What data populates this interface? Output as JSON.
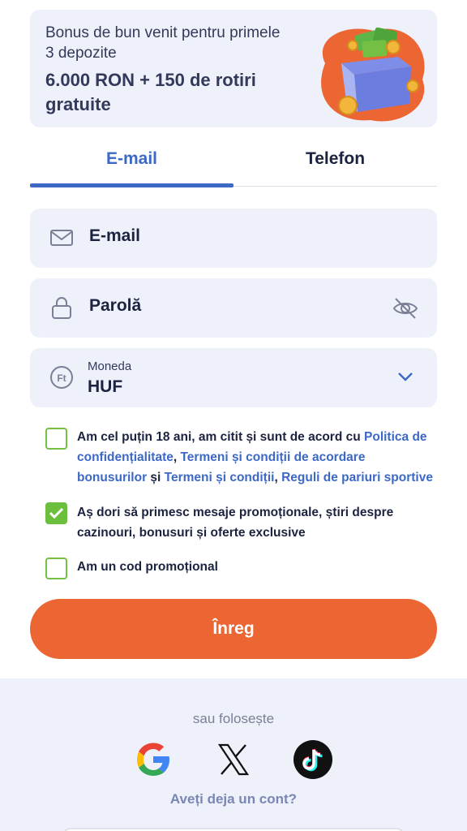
{
  "promo": {
    "subtitle": "Bonus de bun venit pentru primele 3 depozite",
    "headline": "6.000 RON + 150 de rotiri gratuite",
    "art_icon": "money-box-icon"
  },
  "tabs": [
    {
      "label": "E-mail",
      "active": true
    },
    {
      "label": "Telefon",
      "active": false
    }
  ],
  "form": {
    "email": {
      "placeholder": "E-mail",
      "icon": "mail-icon"
    },
    "password": {
      "placeholder": "Parolă",
      "icon": "lock-icon",
      "toggle_icon": "eye-off-icon"
    },
    "currency": {
      "label": "Moneda",
      "value": "HUF",
      "icon": "forint-icon"
    }
  },
  "consents": {
    "terms": {
      "checked": false,
      "text_1": "Am cel puțin 18 ani, am citit și sunt de acord cu ",
      "link_privacy": "Politica de confidențialitate",
      "sep_1": ", ",
      "link_bonus_terms": "Termeni și condiții de acordare bonusurilor",
      "sep_2": " și ",
      "link_terms": "Termeni și condiții",
      "sep_3": ", ",
      "link_sports_rules": "Reguli de pariuri sportive"
    },
    "marketing": {
      "checked": true,
      "text": "Aș dori să primesc mesaje promoționale, știri despre cazinouri, bonusuri și oferte exclusive"
    },
    "promo_code": {
      "checked": false,
      "text": "Am un cod promoțional"
    }
  },
  "submit_label": "Înreg",
  "footer": {
    "or_text": "sau folosește",
    "social": [
      "google-icon",
      "x-icon",
      "tiktok-icon"
    ],
    "have_account": "Aveți deja un cont?"
  },
  "colors": {
    "accent_blue": "#3c68c6",
    "cta_orange": "#ec6634",
    "check_green": "#6cbf3c",
    "field_bg": "#eef1f9",
    "text_dark": "#1c2340"
  }
}
